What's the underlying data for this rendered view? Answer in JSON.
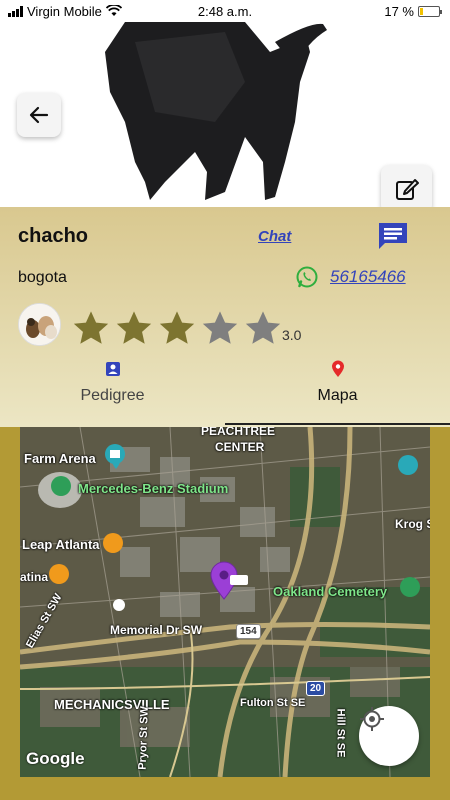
{
  "status_bar": {
    "carrier": "Virgin Mobile",
    "time": "2:48 a.m.",
    "battery": "17 %"
  },
  "pet": {
    "name": "chacho",
    "city": "bogota",
    "phone": "56165466",
    "rating": "3.0",
    "rating_value": 3,
    "rating_max": 5
  },
  "actions": {
    "chat_label": "Chat"
  },
  "tabs": [
    {
      "label": "Pedigree",
      "icon": "pedigree-badge-icon",
      "selected": false
    },
    {
      "label": "Mapa",
      "icon": "location-pin-icon",
      "selected": true
    }
  ],
  "map": {
    "labels": {
      "peachtree": "PEACHTREE",
      "center": "CENTER",
      "farm_arena": "Farm Arena",
      "mercedes": "Mercedes-Benz Stadium",
      "leap": "Leap Atlanta",
      "atina": "atina",
      "krog": "Krog S",
      "elias": "Elias St SW",
      "memorial": "Memorial Dr SW",
      "oakland": "Oakland Cemetery",
      "mechanicsville": "MECHANICSVILLE",
      "fulton": "Fulton St SE",
      "hill": "Hill St SE",
      "pryor": "Pryor St SW",
      "hwy154": "154",
      "hwy20": "20",
      "google": "Google"
    }
  },
  "colors": {
    "accent_blue": "#3344bb",
    "star_filled": "#7d7430",
    "star_empty": "#7f7f7f",
    "pin_purple": "#9b3fd6",
    "whatsapp_green": "#2fae3e",
    "page_gold": "#b39a35"
  }
}
